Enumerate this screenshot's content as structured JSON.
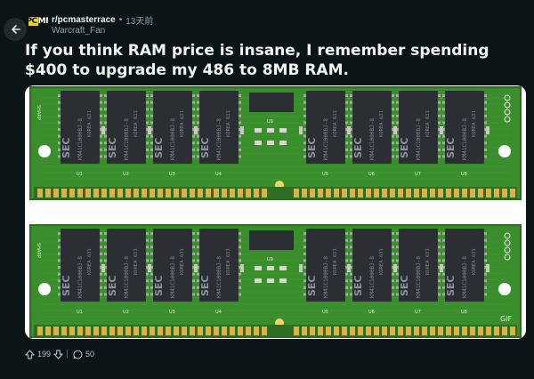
{
  "post": {
    "subreddit": "r/pcmasterrace",
    "separator": "•",
    "age": "13天前",
    "author": "Warcraft_Fan",
    "title": "If you think RAM price is insane, I remember spending $400 to upgrade my 486 to 8MB RAM.",
    "logo_text_a": "PC",
    "logo_text_b": "MR"
  },
  "image": {
    "module_labels": [
      "SHARP"
    ],
    "chip_brand": "SEC",
    "chip_text_a": "KM41C1000BJ-8",
    "chip_text_b": "KOREA 631",
    "module_numbers": [
      "U1",
      "U2",
      "U3",
      "U4",
      "U5",
      "U6",
      "U7",
      "U8",
      "U9"
    ],
    "corner_text": "GIF"
  },
  "actions": {
    "upvotes": "199",
    "comments": "50"
  },
  "colors": {
    "background": "#0b1416",
    "pcb": "#3a8f2c",
    "chip": "#2b2f33",
    "gold": "#d9b24a"
  }
}
